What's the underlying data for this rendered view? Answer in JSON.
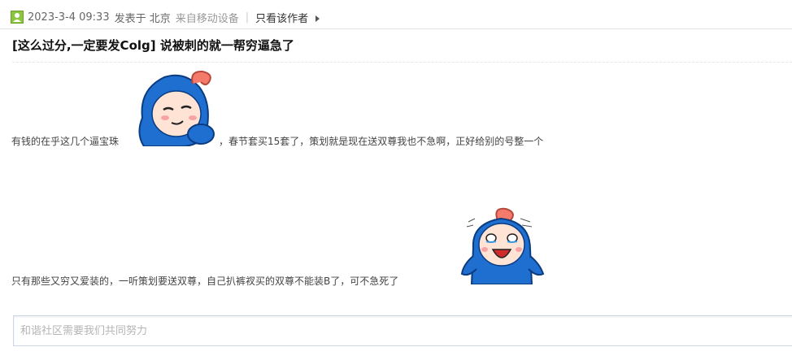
{
  "post_meta": {
    "date": "2023-3-4 09:33",
    "posted_at_label": "发表于 北京",
    "device": "来自移动设备",
    "separator": "|",
    "only_author_label": "只看该作者",
    "author_icon": "user-avatar-icon"
  },
  "post": {
    "title": "[这么过分,一定要发Colg] 说被刺的就一帮穷逼急了",
    "paragraph1_part1": "有钱的在乎这几个逼宝珠",
    "paragraph1_part2": "，春节套买15套了，策划就是现在送双尊我也不急啊，正好给别的号整一个",
    "paragraph2": "只有那些又穷又爱装的，一听策划要送双尊，自己扒裤衩买的双尊不能装B了，可不急死了",
    "sticker1": "smug-blue-mascot-emoji",
    "sticker2": "laughing-crying-blue-mascot-emoji"
  },
  "comment": {
    "placeholder": "和谐社区需要我们共同努力",
    "value": ""
  },
  "colors": {
    "accent_green": "#8cc63f",
    "mascot_blue": "#1f6fd1",
    "border_blue": "#c9d7e6"
  }
}
